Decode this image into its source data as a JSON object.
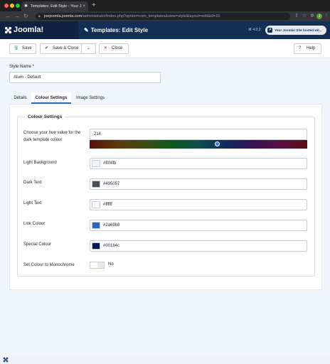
{
  "browser": {
    "tab_title": "Templates: Edit Style - Your J",
    "tab_close": "×",
    "new_tab": "+",
    "url_host": "joejoomla.joomla.com",
    "url_path": "/administrator/index.php?option=com_templates&view=style&layout=edit&id=16",
    "profile_initial": "J"
  },
  "header": {
    "logo_text": "Joomla!",
    "page_title": "Templates: Edit Style",
    "version": "⌘ 4.0.2",
    "site_pill": "Your Joomla! Site hosted wit..."
  },
  "toolbar": {
    "save": "Save",
    "save_close": "Save & Close",
    "close": "Close",
    "help": "Help"
  },
  "form": {
    "style_name_label": "Style Name *",
    "style_name_value": "Atum - Default",
    "tabs": [
      "Details",
      "Colour Settings",
      "Image Settings"
    ],
    "active_tab": "Colour Settings",
    "fieldset_legend": "Colour Settings",
    "hue_label_1": "Choose your hue value for the",
    "hue_label_2": "dark template colour",
    "hue_value": "214",
    "hue_fraction": 0.59,
    "light_bg_label": "Light Background",
    "light_bg_value": "#f0f4fb",
    "dark_text_label": "Dark Text",
    "dark_text_value": "#495057",
    "light_text_label": "Light Text",
    "light_text_value": "#ffffff",
    "link_colour_label": "Link Colour",
    "link_colour_value": "#2a69b8",
    "special_colour_label": "Special Colour",
    "special_colour_value": "#001b4c",
    "monochrome_label": "Set Colour to Monochrome",
    "monochrome_value": "No"
  },
  "colors": {
    "header_bg": "#132f53",
    "link": "#2a69b8",
    "close_red": "#c52827"
  },
  "icons": {
    "save": "save-icon",
    "check": "check-icon",
    "close": "close-x-icon",
    "help": "question-icon",
    "pencil": "pencil-icon"
  }
}
